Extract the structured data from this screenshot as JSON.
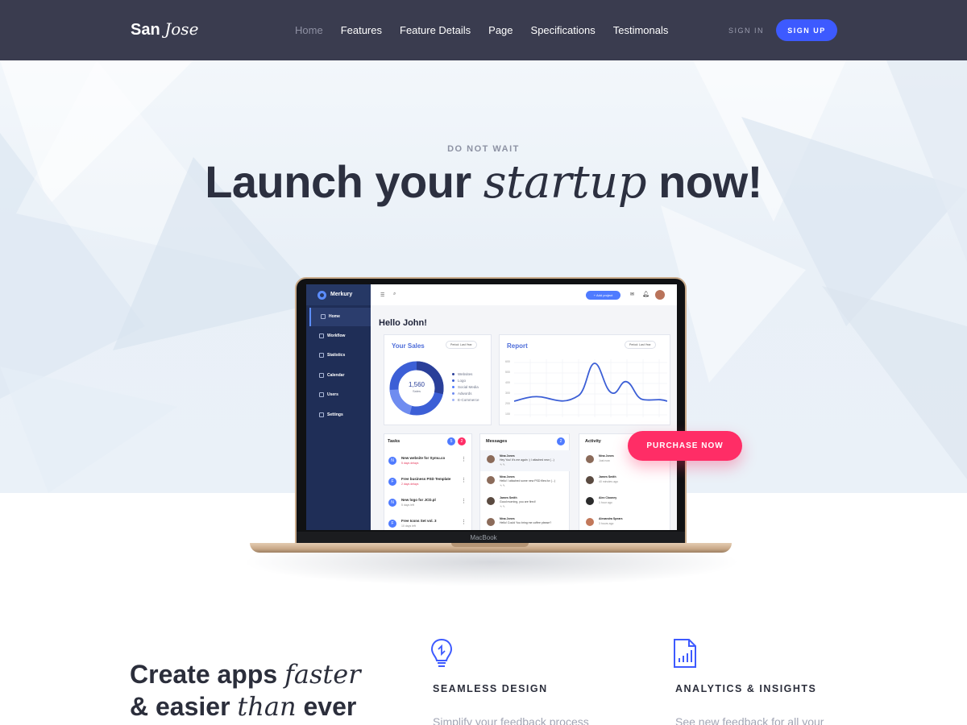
{
  "brand": {
    "name": "San",
    "name_italic": "Jose"
  },
  "nav": {
    "links": [
      "Home",
      "Features",
      "Feature Details",
      "Page",
      "Specifications",
      "Testimonals"
    ],
    "signin": "SIGN IN",
    "signup": "SIGN UP"
  },
  "hero": {
    "eyebrow": "DO NOT WAIT",
    "headline_start": "Launch your",
    "headline_italic": "startup",
    "headline_end": "now!",
    "purchase": "PURCHASE NOW"
  },
  "laptop": {
    "label": "MacBook"
  },
  "dashboard": {
    "brand": "Merkury",
    "sidebar": [
      "Home",
      "Workflow",
      "Statistics",
      "Calendar",
      "Users",
      "Settings"
    ],
    "add_project": "+ Add project",
    "greeting": "Hello John!",
    "sales": {
      "title": "Your Sales",
      "period": "Period: Last Year",
      "total": "1,560",
      "total_label": "Sales",
      "legend": [
        "Websites",
        "Logo",
        "Social Media",
        "Adwords",
        "E-Commerce"
      ]
    },
    "report": {
      "title": "Report",
      "period": "Period: Last Year",
      "yticks": [
        "600",
        "500",
        "400",
        "300",
        "200",
        "100"
      ]
    },
    "tasks": {
      "title": "Tasks",
      "badge_a": "5",
      "badge_b": "2",
      "items": [
        {
          "initial": "N",
          "name": "New website for Symu.co",
          "due": "5 days delays"
        },
        {
          "initial": "F",
          "name": "Free business PSD Template",
          "due": "2 days delays"
        },
        {
          "initial": "N",
          "name": "New logo for JCD.pl",
          "due": "5 days left"
        },
        {
          "initial": "F",
          "name": "Free Icons Set vol. 3",
          "due": "10 days left"
        }
      ]
    },
    "messages": {
      "title": "Messages",
      "badge": "2",
      "items": [
        {
          "name": "Nina Jones",
          "text": "Hey You! It's me again :) I attached new (...)"
        },
        {
          "name": "Nina Jones",
          "text": "Hello! I attached some new PSD files for (...)"
        },
        {
          "name": "James Smith",
          "text": "Good morning, you are fired!"
        },
        {
          "name": "Nina Jones",
          "text": "Hello! Could You bring me coffee please?"
        }
      ]
    },
    "activity": {
      "title": "Activity",
      "items": [
        {
          "name": "Nina Jones",
          "text": "added a new project",
          "time": "Just now"
        },
        {
          "name": "James Smith",
          "text": "commented project Free PSD Template",
          "time": "40 minutes ago"
        },
        {
          "name": "Alex Clooney",
          "text": "completed task Symu Website",
          "time": "1 hour ago"
        },
        {
          "name": "Alexandra Spears",
          "text": "added a new project Free PSD",
          "time": "3 hours ago"
        }
      ]
    }
  },
  "features": {
    "headline_line1_start": "Create apps",
    "headline_line1_italic": "faster",
    "headline_line2_start": "& easier",
    "headline_line2_italic": "than",
    "headline_line2_end": "ever",
    "items": [
      {
        "icon": "lightbulb-icon",
        "title": "SEAMLESS DESIGN",
        "text": "Simplify your feedback process"
      },
      {
        "icon": "report-icon",
        "title": "ANALYTICS & INSIGHTS",
        "text": "See new feedback for all your"
      }
    ]
  },
  "colors": {
    "nav_bg": "#3a3c4f",
    "accent_blue": "#3d5aff",
    "accent_pink": "#ff2d66",
    "sidebar_bg": "#1f2e57"
  }
}
